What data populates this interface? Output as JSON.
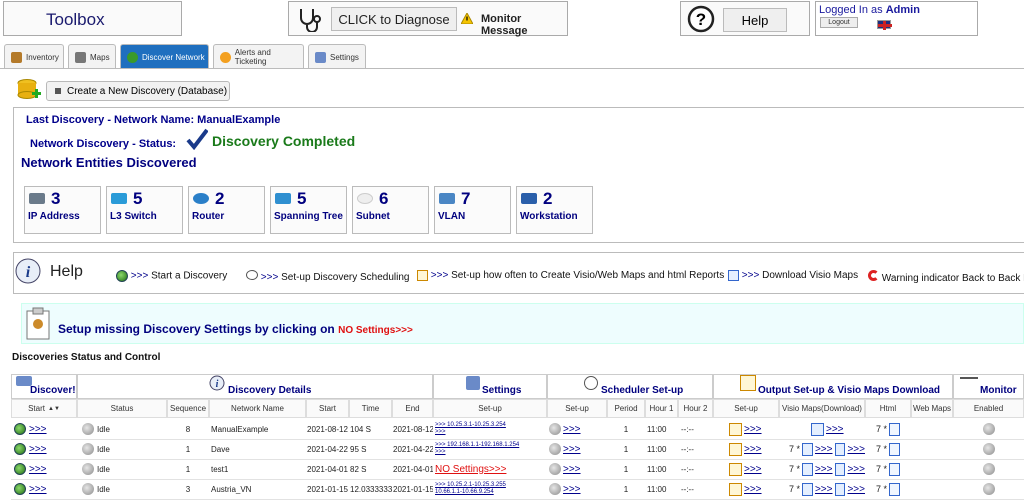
{
  "header": {
    "toolbox": "Toolbox",
    "diagnose_label": "CLICK to Diagnose",
    "monitor_message": "Monitor Message",
    "help_label": "Help",
    "logged_in_as": "Logged In as",
    "user": "Admin",
    "logout_label": "Logout"
  },
  "tabs": [
    {
      "label": "Inventory"
    },
    {
      "label": "Maps"
    },
    {
      "label": "Discover Network"
    },
    {
      "label": "Alerts and Ticketing"
    },
    {
      "label": "Settings"
    }
  ],
  "create_label": "Create a New Discovery (Database)",
  "last": {
    "title": "Last Discovery - Network Name: ManualExample",
    "status_label": "Network Discovery - Status:",
    "status": "Discovery Completed",
    "entities_title": "Network Entities Discovered"
  },
  "entities": [
    {
      "count": "3",
      "label": "IP Address",
      "color": "#6a7a8a"
    },
    {
      "count": "5",
      "label": "L3 Switch",
      "color": "#2a9bd8"
    },
    {
      "count": "2",
      "label": "Router",
      "color": "#2a7fc8"
    },
    {
      "count": "5",
      "label": "Spanning Tree",
      "color": "#2f8fd0"
    },
    {
      "count": "6",
      "label": "Subnet",
      "color": "#e8e8e8"
    },
    {
      "count": "7",
      "label": "VLAN",
      "color": "#4a86c4"
    },
    {
      "count": "2",
      "label": "Workstation",
      "color": "#2a5faa"
    }
  ],
  "helpbar": {
    "help": "Help",
    "start_link": ">>>",
    "start_text": "Start a Discovery",
    "sched_link": ">>>",
    "sched_text": "Set-up Discovery Scheduling",
    "maps_link": ">>>",
    "maps_text": "Set-up how often to Create Visio/Web Maps and html Reports",
    "visio_link": ">>>",
    "visio_text": "Download Visio Maps",
    "warn_text": "Warning indicator Back to Back R"
  },
  "setup": {
    "text": "Setup missing Discovery Settings by clicking on",
    "link": "NO Settings>>>"
  },
  "status_title": "Discoveries Status and Control",
  "groups": {
    "discover": "Discover!",
    "details": "Discovery Details",
    "settings": "Settings",
    "scheduler": "Scheduler Set-up",
    "output": "Output Set-up & Visio Maps Download",
    "monitor": "Monitor"
  },
  "cols": {
    "start": "Start",
    "status": "Status",
    "sequence": "Sequence",
    "network_name": "Network Name",
    "start2": "Start",
    "time": "Time",
    "end": "End",
    "setup": "Set-up",
    "sch_setup": "Set-up",
    "period": "Period",
    "hour1": "Hour 1",
    "hour2": "Hour 2",
    "out_setup": "Set-up",
    "visio": "Visio Maps(Download)",
    "html": "Html",
    "web": "Web Maps",
    "enabled": "Enabled"
  },
  "rows": [
    {
      "go": ">>>",
      "status": "Idle",
      "seq": "8",
      "name": "ManualExample",
      "start": "2021-08-12",
      "time": "104 S",
      "end": "2021-08-12",
      "range1": ">>> 10.25.3.1-10.25.3.254",
      "range2": ">>>",
      "nosettings": "",
      "sched": ">>>",
      "period": "1",
      "h1": "11:00",
      "h2": "--:--",
      "out": ">>>",
      "visio": "",
      "html": "7",
      "web": ""
    },
    {
      "go": ">>>",
      "status": "Idle",
      "seq": "1",
      "name": "Dave",
      "start": "2021-04-22",
      "time": "95 S",
      "end": "2021-04-22",
      "range1": ">>> 192.168.1.1-192.168.1.254",
      "range2": ">>>",
      "nosettings": "",
      "sched": ">>>",
      "period": "1",
      "h1": "11:00",
      "h2": "--:--",
      "out": ">>>",
      "visio": "7",
      "html": "7",
      "web": ""
    },
    {
      "go": ">>>",
      "status": "Idle",
      "seq": "1",
      "name": "test1",
      "start": "2021-04-01",
      "time": "82 S",
      "end": "2021-04-01",
      "range1": "",
      "range2": "",
      "nosettings": "NO Settings>>>",
      "sched": ">>>",
      "period": "1",
      "h1": "11:00",
      "h2": "--:--",
      "out": ">>>",
      "visio": "7",
      "html": "7",
      "web": ""
    },
    {
      "go": ">>>",
      "status": "Idle",
      "seq": "3",
      "name": "Austria_VN",
      "start": "2021-01-15",
      "time": "12.0333333",
      "end": "2021-01-15",
      "range1": ">>> 10.25.2.1-10.25.3.255",
      "range2": "10.66.1.1-10.66.9.254",
      "nosettings": "",
      "sched": ">>>",
      "period": "1",
      "h1": "11:00",
      "h2": "--:--",
      "out": ">>>",
      "visio": "7",
      "html": "7",
      "web": ""
    }
  ]
}
